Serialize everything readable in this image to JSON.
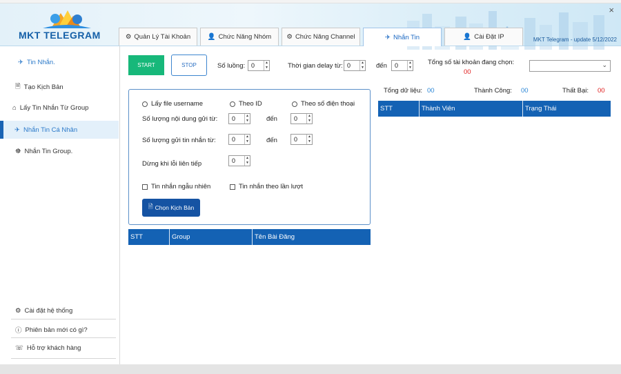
{
  "header": {
    "app_name": "MKT TELEGRAM",
    "version": "MKT Telegram - update 5/12/2022",
    "close_glyph": "×",
    "tabs": [
      {
        "icon": "⚙",
        "label": "Quản Lý Tài Khoản"
      },
      {
        "icon": "👤",
        "label": "Chức Năng Nhóm"
      },
      {
        "icon": "⚙",
        "label": "Chức Năng Channel"
      },
      {
        "icon": "✈",
        "label": "Nhắn Tin"
      },
      {
        "icon": "👤",
        "label": "Cài Đặt IP"
      }
    ],
    "active_tab": 3
  },
  "sidebar": {
    "title": "Tin Nhắn.",
    "title_icon": "✈",
    "items": [
      {
        "icon": "🗎",
        "label": "Tạo Kịch Bản"
      },
      {
        "icon": "⌂",
        "label": "Lấy Tin Nhắn Từ Group"
      },
      {
        "icon": "✈",
        "label": "Nhắn Tin Cá Nhân"
      },
      {
        "icon": "☸",
        "label": "Nhắn Tin Group."
      }
    ],
    "active_item": 2,
    "bottom": [
      {
        "icon": "⚙",
        "label": "Cài đặt hệ thống"
      },
      {
        "icon": "ⓘ",
        "label": "Phiên bản mới có gì?"
      },
      {
        "icon": "☏",
        "label": "Hỗ trợ khách hàng"
      }
    ]
  },
  "toolbar": {
    "start_label": "START",
    "stop_label": "STOP",
    "threads_label": "Số luồng:",
    "threads_value": "0",
    "delay_label": "Thời gian delay từ:",
    "delay_from": "0",
    "to_label": "đến",
    "delay_to": "0",
    "total_accounts_label": "Tổng số tài khoản đang chọn:",
    "total_accounts_value": "00",
    "account_select_value": ""
  },
  "settings": {
    "radio_username": "Lấy file username",
    "radio_id": "Theo ID",
    "radio_phone": "Theo số điện thoại",
    "content_label": "Số lượng nội dung gửi từ:",
    "content_from": "0",
    "content_to": "0",
    "messages_label": "Số lượng gửi tin nhắn từ:",
    "messages_from": "0",
    "messages_to": "0",
    "to_label": "đến",
    "stop_on_error_label": "Dừng khi lỗi liên tiếp",
    "stop_on_error_value": "0",
    "random_label": "Tin nhắn ngẫu nhiên",
    "sequential_label": "Tin nhắn theo lần lượt",
    "choose_script_label": "Chọn Kịch Bản"
  },
  "left_table": {
    "columns": [
      "STT",
      "Group",
      "Tên Bài Đăng"
    ]
  },
  "stats": {
    "total_label": "Tổng dữ liệu:",
    "total_value": "00",
    "success_label": "Thành Công:",
    "success_value": "00",
    "fail_label": "Thất Bại:",
    "fail_value": "00"
  },
  "right_table": {
    "columns": [
      "STT",
      "Thành Viên",
      "Trạng Thái"
    ]
  },
  "colors": {
    "primary": "#1462b4",
    "start": "#17b87a",
    "accent": "#2b79c9",
    "error": "#e02020"
  }
}
